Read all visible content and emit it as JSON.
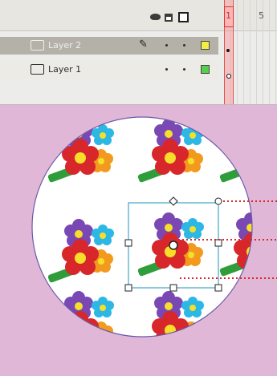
{
  "timeline": {
    "frame_numbers": [
      "1",
      "5"
    ],
    "layers": [
      {
        "name": "Layer 2",
        "selected": true,
        "color": "#f3ee45"
      },
      {
        "name": "Layer 1",
        "selected": false,
        "color": "#56cf4f"
      }
    ],
    "icons": [
      "eye-icon",
      "lock-icon",
      "outline-icon",
      "pencil-icon",
      "layer-icon"
    ]
  },
  "stage": {
    "background": "#e1b7d8",
    "mask_shape": "circle",
    "pattern": "flower bouquets",
    "flower_colors": [
      "#d8272b",
      "#7a48b3",
      "#2cb7e5",
      "#f39a1e",
      "#f6df2a",
      "#2f9d3a"
    ]
  }
}
